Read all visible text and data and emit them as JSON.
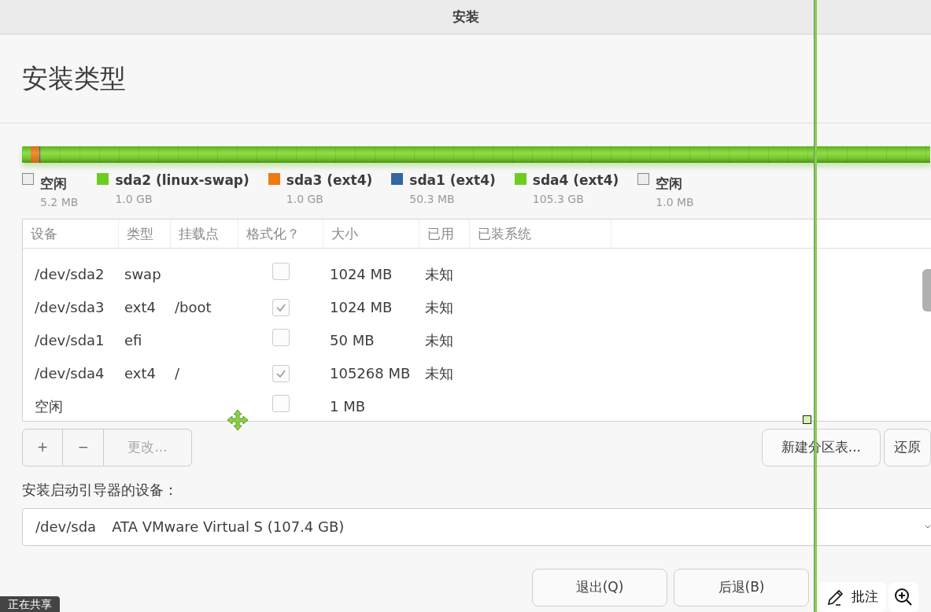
{
  "window": {
    "title": "安装"
  },
  "heading": "安装类型",
  "partitions": [
    {
      "name": "空闲",
      "size": "5.2 MB",
      "color": "#eeeeee",
      "kind": "free"
    },
    {
      "name": "sda2 (linux-swap)",
      "size": "1.0 GB",
      "color": "#6ccd21",
      "level": 0.0095,
      "kind": "used"
    },
    {
      "name": "sda3 (ext4)",
      "size": "1.0 GB",
      "color": "#ee7a14",
      "level": 0.0095,
      "kind": "used"
    },
    {
      "name": "sda1 (ext4)",
      "size": "50.3 MB",
      "color": "#3465a4",
      "level": 0.0005,
      "kind": "used"
    },
    {
      "name": "sda4 (ext4)",
      "size": "105.3 GB",
      "color": "#6ccd21",
      "level": 0.98,
      "kind": "used"
    },
    {
      "name": "空闲",
      "size": "1.0 MB",
      "color": "#eeeeee",
      "kind": "free"
    }
  ],
  "table": {
    "columns": [
      "设备",
      "类型",
      "挂载点",
      "格式化？",
      "大小",
      "已用",
      "已装系统"
    ],
    "rows": [
      {
        "device": "/dev/sda2",
        "type": "swap",
        "format": {
          "checked": false
        },
        "size": "1024 MB",
        "used": "未知"
      },
      {
        "device": "/dev/sda3",
        "type": "ext4",
        "mount": "/boot",
        "format": {
          "checked": true
        },
        "size": "1024 MB",
        "used": "未知"
      },
      {
        "device": "/dev/sda1",
        "type": "efi",
        "format": {
          "checked": false
        },
        "size": "50 MB",
        "used": "未知"
      },
      {
        "device": "/dev/sda4",
        "type": "ext4",
        "mount": "/",
        "format": {
          "checked": true
        },
        "size": "105268 MB",
        "used": "未知"
      },
      {
        "device": "空闲",
        "format": {
          "checked": false
        },
        "size": "1 MB"
      }
    ]
  },
  "partition_buttons": [
    {
      "label": "+",
      "disabled": false
    },
    {
      "label": "−",
      "disabled": false
    },
    {
      "label": "更改...",
      "disabled": true
    }
  ],
  "table_buttons": [
    "新建分区表...",
    "还原"
  ],
  "bootloader": {
    "label": "安装启动引导器的设备：",
    "device": "/dev/sda",
    "description": "ATA VMware Virtual S (107.4 GB)"
  },
  "footer_buttons": [
    "退出(Q)",
    "后退(B)"
  ],
  "annotation_toolbar": {
    "label": "批注"
  },
  "share_banner": "正在共享"
}
